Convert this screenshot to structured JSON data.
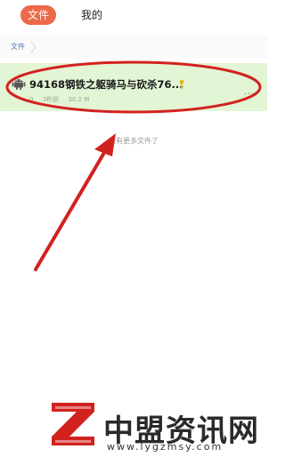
{
  "tabs": [
    {
      "label": "文件",
      "active": true
    },
    {
      "label": "我的",
      "active": false
    }
  ],
  "breadcrumb": {
    "label": "文件"
  },
  "file": {
    "title": "94168钢铁之躯骑马与砍杀76...",
    "meta_count": "0",
    "meta_time": "3秒前",
    "meta_size": "30.2 M",
    "icon": "android-icon",
    "key_icon": "key-icon",
    "more_label": "···"
  },
  "empty_note": "没有更多文件了",
  "watermark": {
    "title": "中盟资讯网",
    "url": "www.lygzmsy.com"
  },
  "colors": {
    "accent": "#ec6a4a",
    "row_highlight": "#e2f5d5",
    "annotation_red": "#d2221f"
  }
}
